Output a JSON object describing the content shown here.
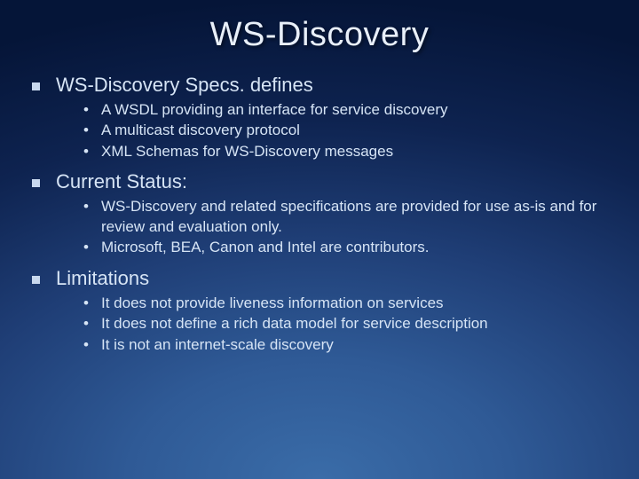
{
  "title": "WS-Discovery",
  "sections": [
    {
      "heading": "WS-Discovery Specs. defines",
      "items": [
        "A WSDL providing an interface for service discovery",
        "A multicast discovery protocol",
        "XML Schemas for WS-Discovery messages"
      ]
    },
    {
      "heading": "Current Status:",
      "items": [
        "WS-Discovery and related specifications are provided for use as-is and for review and evaluation only.",
        "  Microsoft, BEA, Canon and Intel are contributors."
      ]
    },
    {
      "heading": "Limitations",
      "items": [
        "It does not provide liveness information on services",
        "It does not define a rich data model for service description",
        "It is not an internet-scale discovery"
      ]
    }
  ]
}
